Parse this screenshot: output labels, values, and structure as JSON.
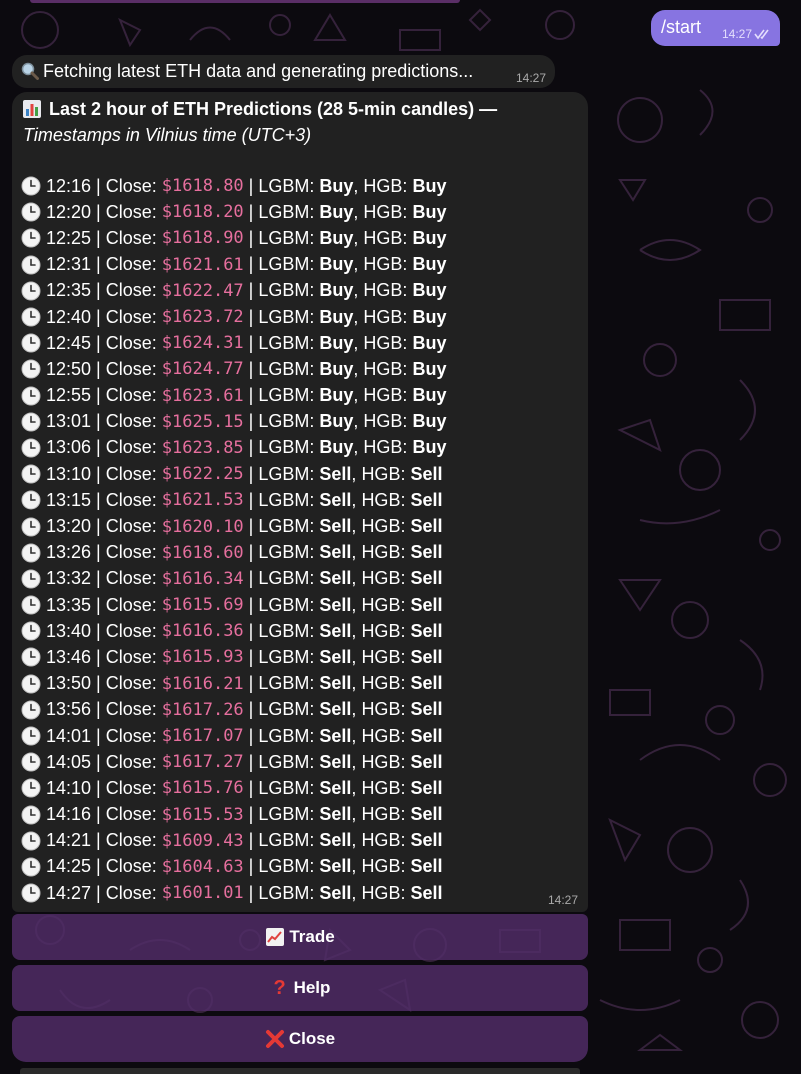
{
  "outgoing": {
    "text": "/start",
    "time": "14:27"
  },
  "status_message": {
    "text": "Fetching latest ETH data and generating predictions...",
    "time": "14:27"
  },
  "predictions": {
    "title": "Last 2 hour of ETH Predictions (28 5-min candles) —",
    "subtitle": "Timestamps in Vilnius time (UTC+3)",
    "time": "14:27",
    "close_label": "Close:",
    "lgbm_label": "LGBM:",
    "hgb_label": "HGB:",
    "rows": [
      {
        "time": "12:16",
        "close": "$1618.80",
        "lgbm": "Buy",
        "hgb": "Buy"
      },
      {
        "time": "12:20",
        "close": "$1618.20",
        "lgbm": "Buy",
        "hgb": "Buy"
      },
      {
        "time": "12:25",
        "close": "$1618.90",
        "lgbm": "Buy",
        "hgb": "Buy"
      },
      {
        "time": "12:31",
        "close": "$1621.61",
        "lgbm": "Buy",
        "hgb": "Buy"
      },
      {
        "time": "12:35",
        "close": "$1622.47",
        "lgbm": "Buy",
        "hgb": "Buy"
      },
      {
        "time": "12:40",
        "close": "$1623.72",
        "lgbm": "Buy",
        "hgb": "Buy"
      },
      {
        "time": "12:45",
        "close": "$1624.31",
        "lgbm": "Buy",
        "hgb": "Buy"
      },
      {
        "time": "12:50",
        "close": "$1624.77",
        "lgbm": "Buy",
        "hgb": "Buy"
      },
      {
        "time": "12:55",
        "close": "$1623.61",
        "lgbm": "Buy",
        "hgb": "Buy"
      },
      {
        "time": "13:01",
        "close": "$1625.15",
        "lgbm": "Buy",
        "hgb": "Buy"
      },
      {
        "time": "13:06",
        "close": "$1623.85",
        "lgbm": "Buy",
        "hgb": "Buy"
      },
      {
        "time": "13:10",
        "close": "$1622.25",
        "lgbm": "Sell",
        "hgb": "Sell"
      },
      {
        "time": "13:15",
        "close": "$1621.53",
        "lgbm": "Sell",
        "hgb": "Sell"
      },
      {
        "time": "13:20",
        "close": "$1620.10",
        "lgbm": "Sell",
        "hgb": "Sell"
      },
      {
        "time": "13:26",
        "close": "$1618.60",
        "lgbm": "Sell",
        "hgb": "Sell"
      },
      {
        "time": "13:32",
        "close": "$1616.34",
        "lgbm": "Sell",
        "hgb": "Sell"
      },
      {
        "time": "13:35",
        "close": "$1615.69",
        "lgbm": "Sell",
        "hgb": "Sell"
      },
      {
        "time": "13:40",
        "close": "$1616.36",
        "lgbm": "Sell",
        "hgb": "Sell"
      },
      {
        "time": "13:46",
        "close": "$1615.93",
        "lgbm": "Sell",
        "hgb": "Sell"
      },
      {
        "time": "13:50",
        "close": "$1616.21",
        "lgbm": "Sell",
        "hgb": "Sell"
      },
      {
        "time": "13:56",
        "close": "$1617.26",
        "lgbm": "Sell",
        "hgb": "Sell"
      },
      {
        "time": "14:01",
        "close": "$1617.07",
        "lgbm": "Sell",
        "hgb": "Sell"
      },
      {
        "time": "14:05",
        "close": "$1617.27",
        "lgbm": "Sell",
        "hgb": "Sell"
      },
      {
        "time": "14:10",
        "close": "$1615.76",
        "lgbm": "Sell",
        "hgb": "Sell"
      },
      {
        "time": "14:16",
        "close": "$1615.53",
        "lgbm": "Sell",
        "hgb": "Sell"
      },
      {
        "time": "14:21",
        "close": "$1609.43",
        "lgbm": "Sell",
        "hgb": "Sell"
      },
      {
        "time": "14:25",
        "close": "$1604.63",
        "lgbm": "Sell",
        "hgb": "Sell"
      },
      {
        "time": "14:27",
        "close": "$1601.01",
        "lgbm": "Sell",
        "hgb": "Sell"
      }
    ]
  },
  "keyboard": {
    "trade": "Trade",
    "help": "Help",
    "close": "Close"
  },
  "icons": {
    "fetch": "magnifier-icon",
    "title": "bar-chart-icon",
    "row": "clock-icon",
    "trade": "chart-increasing-icon",
    "help": "question-mark-icon",
    "close": "cross-mark-icon",
    "read_status": "double-check-icon"
  },
  "colors": {
    "background": "#0c0a0f",
    "outgoing_bubble": "#8774e1",
    "incoming_bubble": "#212121",
    "price": "#e66f9e",
    "keyboard_button": "#522d69"
  }
}
